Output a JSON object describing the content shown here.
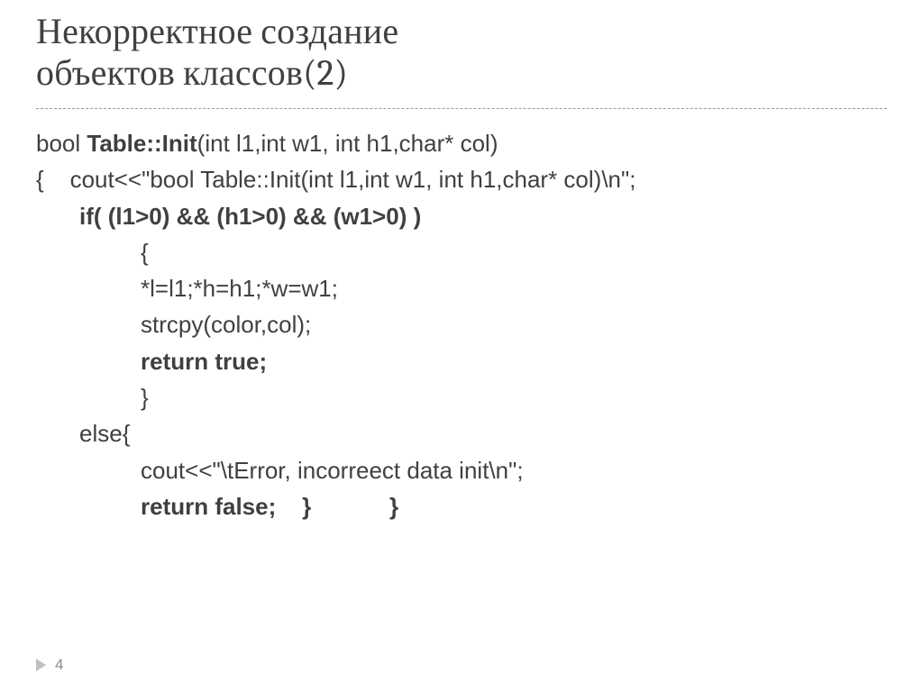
{
  "title": {
    "line1": "Некорректное создание",
    "line2": "объектов классов(2)"
  },
  "code": {
    "l1_a": "bool ",
    "l1_b": "Table::Init",
    "l1_c": "(int l1,int w1, int h1,char* col)",
    "l2": "{    cout<<\"bool Table::Init(int l1,int w1, int h1,char* col)\\n\";",
    "l3": "if( (l1>0) && (h1>0) && (w1>0) )",
    "l4": "{",
    "l5": "*l=l1;*h=h1;*w=w1;",
    "l6": "strcpy(color,col);",
    "l7": "return true;",
    "l8": "}",
    "l9": "else{",
    "l10": "cout<<\"\\tError, incorreect data init\\n\";",
    "l11": "return false;    }            }"
  },
  "page_number": "4"
}
